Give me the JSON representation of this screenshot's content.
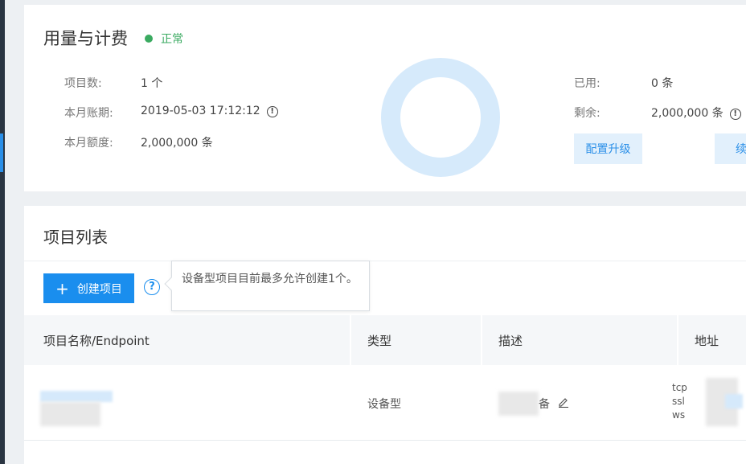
{
  "usage": {
    "title": "用量与计费",
    "status": "正常",
    "status_color": "#3aaa60",
    "project_count_label": "项目数:",
    "project_count_value": "1 个",
    "billing_period_label": "本月账期:",
    "billing_period_value": "2019-05-03 17:12:12",
    "quota_label": "本月额度:",
    "quota_value": "2,000,000 条",
    "used_label": "已用:",
    "used_value": "0 条",
    "remaining_label": "剩余:",
    "remaining_value": "2,000,000 条",
    "upgrade_button": "配置升级",
    "renew_button": "续",
    "donut_used_fraction": 0
  },
  "project_list": {
    "title": "项目列表",
    "create_button": "创建项目",
    "tooltip": "设备型项目目前最多允许创建1个。",
    "columns": [
      "项目名称/Endpoint",
      "类型",
      "描述",
      "地址"
    ],
    "rows": [
      {
        "type": "设备型",
        "description_suffix": "备",
        "address_lines": [
          "tcp",
          "ssl",
          "ws"
        ]
      }
    ]
  },
  "colors": {
    "accent": "#1a8eee",
    "donut": "#d6eafb"
  }
}
